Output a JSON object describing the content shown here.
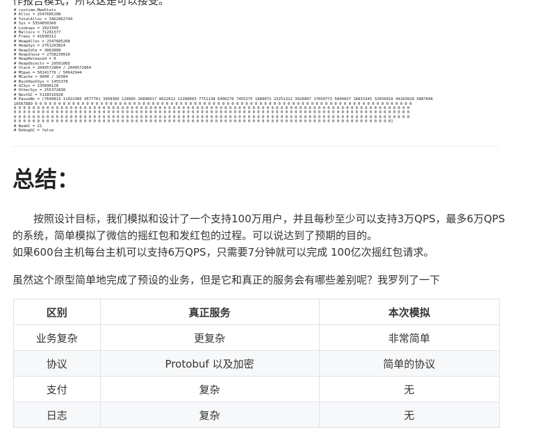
{
  "top_text": "作报告模式，所以这是可以接受。",
  "code_lines": [
    "# runtime.MemStats",
    "# Alloc = 2547685208",
    "# TotalAlloc = 3462862744",
    "# Sys = 5354050360",
    "# Lookups = 1023399",
    "# Mallocs = 71281377",
    "# Frees = 41690312",
    "# HeapAlloc = 2547685208",
    "# HeapSys = 2761293824",
    "# HeapIdle = 3063808",
    "# HeapInuse = 2758230016",
    "# HeapReleased = 0",
    "# HeapObjects = 29591065",
    "# Stack = 2049572864 / 2049572864",
    "# MSpan = 50241776 / 50642944",
    "# MCache = 9600 / 16384",
    "# BuckHashSys = 1455378",
    "# GCSys = 235696128",
    "# OtherSys = 255372838",
    "# NextGC = 5118516928",
    "# PauseNs = [7640813 11022366 4577761 3958360 128985 26896617 8622612 12280603 7751138 6400276 7455275 1889072 23251322 3926897 17650773 5844837 16831945 32656010 44183028 5887846",
    "16567889 0 0 0 0 0 0 0 0 0 0 0 0 0 0 0 0 0 0 0 0 0 0 0 0 0 0 0 0 0 0 0 0 0 0 0 0 0 0 0 0 0 0 0 0 0 0 0 0 0 0 0 0 0 0 0 0 0 0 0 0 0 0 0 0 0 0 0 0 0 0 0 0 0 0 0 0 0 0 0 0 0",
    "0 0 0 0 0 0 0 0 0 0 0 0 0 0 0 0 0 0 0 0 0 0 0 0 0 0 0 0 0 0 0 0 0 0 0 0 0 0 0 0 0 0 0 0 0 0 0 0 0 0 0 0 0 0 0 0 0 0 0 0 0 0 0 0 0 0 0 0 0 0 0 0 0 0 0 0 0 0 0 0 0 0 0 0 0",
    "0 0 0 0 0 0 0 0 0 0 0 0 0 0 0 0 0 0 0 0 0 0 0 0 0 0 0 0 0 0 0 0 0 0 0 0 0 0 0 0 0 0 0 0 0 0 0 0 0 0 0 0 0 0 0 0 0 0 0 0 0 0 0 0 0 0 0 0 0 0 0 0 0 0 0 0 0 0 0 0 0 0 0 0 0",
    "0 0 0 0 0 0 0 0 0 0 0 0 0 0 0 0 0 0 0 0 0 0 0 0 0 0 0 0 0 0 0 0 0 0 0 0 0 0 0 0 0 0 0 0 0 0 0 0 0 0 0 0 0 0 0 0 0 0 0 0 0 0 0 0 0 0 0 0 0 0 0 0 0 0 0 0 0 0 0 0 0 0 0 0 0",
    "0 0 0 0 0 0 0 0 0 0 0 0 0 0 0 0 0 0 0 0 0 0 0 0 0 0 0 0 0 0 0 0 0 0 0 0 0 0 0 0 0 0 0 0 0 0 0 0 0 0 0 0 0 0 0 0 0 0 0 0 0 0 0 0 0 0 0 0 0 0 0 0 0 0 0 0 0 0 0 0 0]",
    "# NumGC = 21",
    "# DebugGC = false"
  ],
  "section_title": "总结：",
  "para1_line1": "　　按照设计目标，我们模拟和设计了一个支持100万用户，并且每秒至少可以支持3万QPS，最多6万QPS的系统，简单模拟了微信的摇红包和发红包的过程。可以说达到了预期的目的。",
  "para1_line2": "如果600台主机每台主机可以支持6万QPS，只需要7分钟就可以完成 100亿次摇红包请求。",
  "para2": "虽然这个原型简单地完成了预设的业务，但是它和真正的服务会有哪些差别呢？我罗列了一下",
  "table": {
    "headers": [
      "区别",
      "真正服务",
      "本次模拟"
    ],
    "rows": [
      [
        "业务复杂",
        "更复杂",
        "非常简单"
      ],
      [
        "协议",
        "Protobuf 以及加密",
        "简单的协议"
      ],
      [
        "支付",
        "复杂",
        "无"
      ],
      [
        "日志",
        "复杂",
        "无"
      ]
    ]
  }
}
